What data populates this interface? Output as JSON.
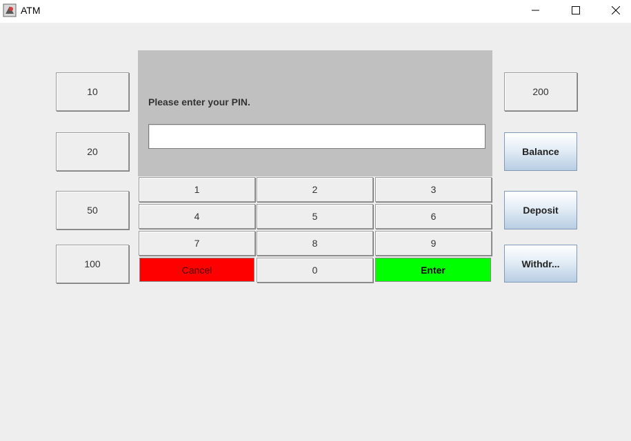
{
  "window": {
    "title": "ATM",
    "controls": {
      "minimize": "—",
      "maximize": "☐",
      "close": "✕"
    }
  },
  "display": {
    "prompt": "Please enter your PIN.",
    "pin_value": ""
  },
  "left_amounts": [
    "10",
    "20",
    "50",
    "100"
  ],
  "right_buttons": {
    "amount_200": "200",
    "balance": "Balance",
    "deposit": "Deposit",
    "withdraw": "Withdr..."
  },
  "keypad": {
    "k1": "1",
    "k2": "2",
    "k3": "3",
    "k4": "4",
    "k5": "5",
    "k6": "6",
    "k7": "7",
    "k8": "8",
    "k9": "9",
    "cancel": "Cancel",
    "k0": "0",
    "enter": "Enter"
  },
  "colors": {
    "cancel": "#ff0000",
    "enter": "#00ff00",
    "display_bg": "#c0c0c0",
    "window_bg": "#eeeeee"
  }
}
